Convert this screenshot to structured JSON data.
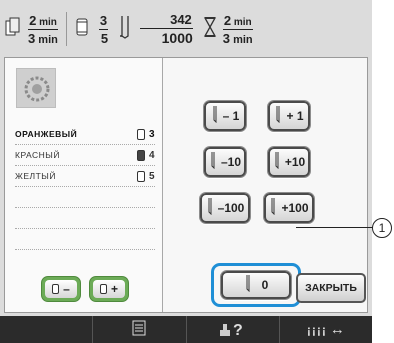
{
  "topbar": {
    "time_top": "2",
    "time_top_unit": "min",
    "time_bot": "3",
    "time_bot_unit": "min",
    "color_top": "3",
    "color_bot": "5",
    "stitch_top": "342",
    "stitch_bot": "1000",
    "timer_top": "2",
    "timer_top_unit": "min",
    "timer_bot": "3",
    "timer_bot_unit": "min"
  },
  "colors": [
    {
      "name": "ОРАНЖЕВЫЙ",
      "number": "3",
      "selected": true,
      "spool": "outline-dark"
    },
    {
      "name": "КРАСНЫЙ",
      "number": "4",
      "selected": false,
      "spool": "dark"
    },
    {
      "name": "ЖЕЛТЫЙ",
      "number": "5",
      "selected": false,
      "spool": "outline"
    }
  ],
  "buttons": {
    "minus1": "– 1",
    "plus1": "+ 1",
    "minus10": "–10",
    "plus10": "+10",
    "minus100": "–100",
    "plus100": "+100",
    "zero": "0",
    "close": "ЗАКРЫТЬ"
  },
  "callout": "1",
  "bottombar": {
    "arrow": "↔"
  }
}
